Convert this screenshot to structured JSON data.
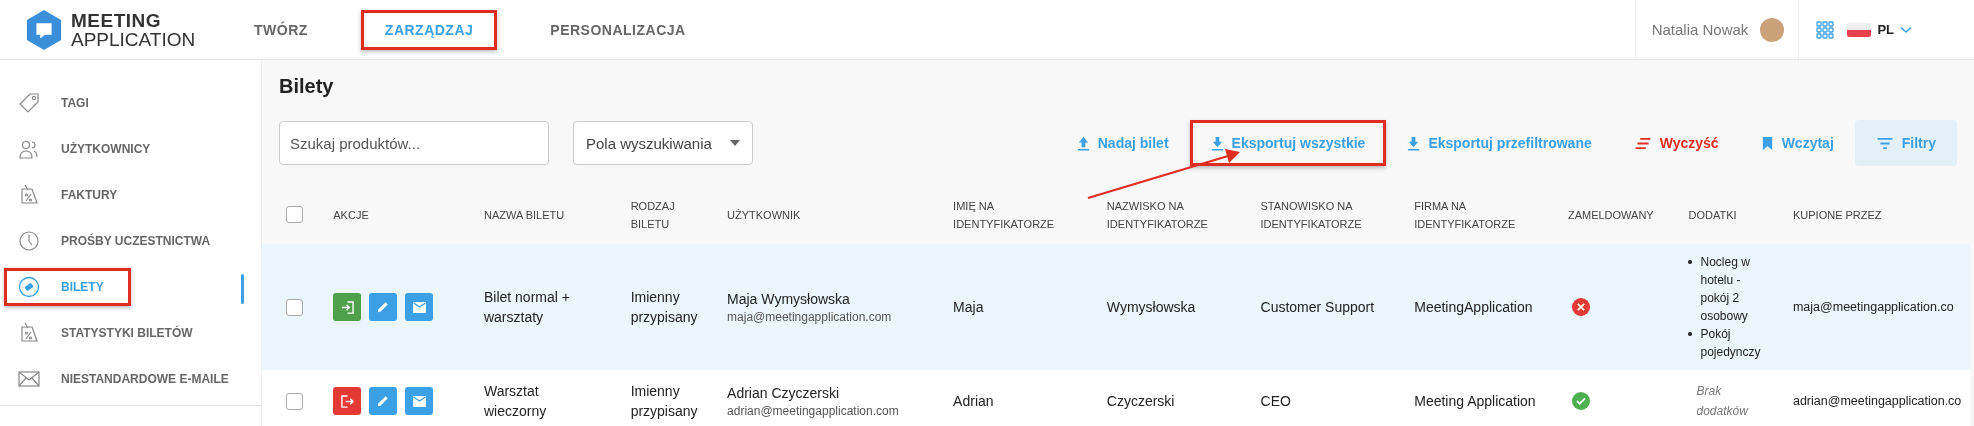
{
  "header": {
    "logo": {
      "line1": "MEETING",
      "line2": "APPLICATION"
    },
    "tabs": [
      {
        "label": "TWÓRZ",
        "selected": false,
        "highlighted": false
      },
      {
        "label": "ZARZĄDZAJ",
        "selected": true,
        "highlighted": true
      },
      {
        "label": "PERSONALIZACJA",
        "selected": false,
        "highlighted": false
      }
    ],
    "user": {
      "name": "Natalia Nowak"
    },
    "language": {
      "code": "PL"
    }
  },
  "sidebar": {
    "items": [
      {
        "label": "TAGI",
        "kind": "tag",
        "selected": false,
        "highlighted": false
      },
      {
        "label": "UŻYTKOWNICY",
        "kind": "users",
        "selected": false,
        "highlighted": false
      },
      {
        "label": "FAKTURY",
        "kind": "percent-tag",
        "selected": false,
        "highlighted": false
      },
      {
        "label": "PROŚBY UCZESTNICTWA",
        "kind": "clock",
        "selected": false,
        "highlighted": false
      },
      {
        "label": "BILETY",
        "kind": "ticket",
        "selected": true,
        "highlighted": true
      },
      {
        "label": "STATYSTYKI BILETÓW",
        "kind": "percent-tag",
        "selected": false,
        "highlighted": false
      },
      {
        "label": "NIESTANDARDOWE E-MAILE",
        "kind": "envelope",
        "selected": false,
        "highlighted": false
      }
    ]
  },
  "page": {
    "title": "Bilety"
  },
  "toolbar": {
    "search": {
      "placeholder": "Szukaj produktów..."
    },
    "search_fields": {
      "value": "Pola wyszukiwania"
    },
    "buttons": [
      {
        "label": "Nadaj bilet",
        "kind": "upload",
        "highlighted": false
      },
      {
        "label": "Eksportuj wszystkie",
        "kind": "download",
        "highlighted": true
      },
      {
        "label": "Eksportuj przefiltrowane",
        "kind": "download",
        "highlighted": false
      },
      {
        "label": "Wyczyść",
        "kind": "clear",
        "highlighted": false
      },
      {
        "label": "Wczytaj",
        "kind": "bookmark",
        "highlighted": false
      },
      {
        "label": "Filtry",
        "kind": "filter",
        "highlighted": false
      }
    ]
  },
  "table": {
    "select_all": {
      "checked": false
    },
    "columns": [
      "AKCJE",
      "NAZWA BILETU",
      "RODZAJ\nBILETU",
      "UŻYTKOWNIK",
      "IMIĘ NA\nIDENTYFIKATORZE",
      "NAZWISKO NA\nIDENTYFIKATORZE",
      "STANOWISKO NA\nIDENTYFIKATORZE",
      "FIRMA NA\nIDENTYFIKATORZE",
      "ZAMELDOWANY",
      "DODATKI",
      "KUPIONE PRZEZ"
    ],
    "rows": [
      {
        "checked": false,
        "highlighted": true,
        "check_button": {
          "kind": "check_in"
        },
        "ticket": "Bilet normal + warsztaty",
        "type": "Imienny przypisany",
        "user_name": "Maja Wymysłowska",
        "user_email": "maja@meetingapplication.com",
        "first_name": "Maja",
        "last_name": "Wymysłowska",
        "position": "Customer Support",
        "company": "MeetingApplication",
        "checked_in": false,
        "extras": [
          "Nocleg w hotelu - pokój 2 osobowy",
          "Pokój pojedynczy"
        ],
        "bought_by": "maja@meetingapplication.co"
      },
      {
        "checked": false,
        "highlighted": false,
        "check_button": {
          "kind": "check_out"
        },
        "ticket": "Warsztat wieczorny",
        "type": "Imienny przypisany",
        "user_name": "Adrian Czyczerski",
        "user_email": "adrian@meetingapplication.com",
        "first_name": "Adrian",
        "last_name": "Czyczerski",
        "position": "CEO",
        "company": "Meeting Application",
        "checked_in": true,
        "extras": [],
        "extras_empty": "Brak dodatków",
        "bought_by": "adrian@meetingapplication.co"
      }
    ]
  }
}
